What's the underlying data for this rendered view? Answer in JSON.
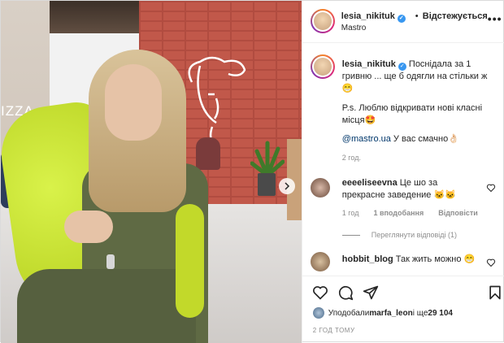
{
  "header": {
    "username": "lesia_nikituk",
    "separator": "•",
    "follow_label": "Відстежується",
    "location": "Mastro",
    "more_label": "•••"
  },
  "photo": {
    "sign_text": "IZZA",
    "next_icon": "chevron-right-icon"
  },
  "caption": {
    "username": "lesia_nikituk",
    "text": "Поснідала за 1 гривню ... ще б одягли на стільки ж 😁",
    "ps": "P.s. Люблю відкривати нові класні місця🤩",
    "mention": "@mastro.ua",
    "mention_rest": " У вас смачно👌🏻",
    "time": "2 год."
  },
  "comments": [
    {
      "username": "eeeeliseevna",
      "text": "Це шо за прекрасне заведение 🐱🐱",
      "time": "1 год",
      "likes": "1 вподобання",
      "reply_label": "Відповісти",
      "view_replies": "Переглянути відповіді (1)"
    },
    {
      "username": "hobbit_blog",
      "text": "Так жить можно 😁"
    }
  ],
  "actions": {
    "liked_by_prefix": "Уподобали ",
    "liked_by_user": "marfa_leon",
    "liked_by_suffix": " і ще ",
    "liked_count": "29 104",
    "post_time": "2 ГОД ТОМУ"
  },
  "colors": {
    "verified": "#3897f0",
    "link": "#00376b",
    "muted": "#8e8e8e"
  }
}
